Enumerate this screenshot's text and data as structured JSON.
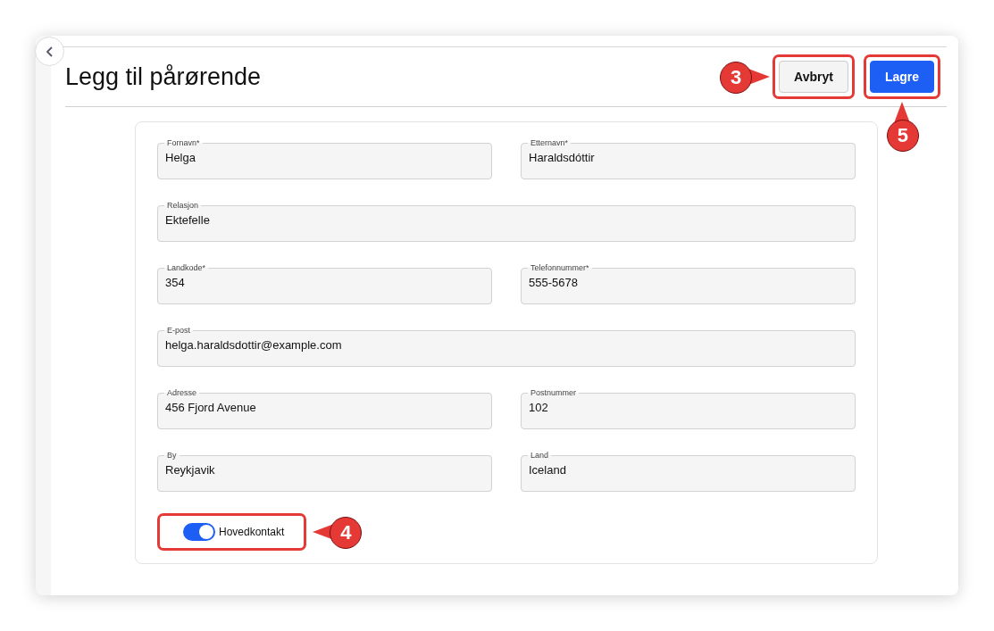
{
  "title": "Legg til pårørende",
  "buttons": [
    {
      "label": "Avbryt",
      "kind": "secondary",
      "callout": "3"
    },
    {
      "label": "Lagre",
      "kind": "primary",
      "callout": "5"
    }
  ],
  "form": {
    "rows": [
      [
        {
          "label": "Fornavn*",
          "value": "Helga"
        },
        {
          "label": "Etternavn*",
          "value": "Haraldsdóttir"
        }
      ],
      [
        {
          "label": "Relasjon",
          "value": "Ektefelle"
        }
      ],
      [
        {
          "label": "Landkode*",
          "value": "354"
        },
        {
          "label": "Telefonnummer*",
          "value": "555-5678"
        }
      ],
      [
        {
          "label": "E-post",
          "value": "helga.haraldsdottir@example.com"
        }
      ],
      [
        {
          "label": "Adresse",
          "value": "456 Fjord Avenue"
        },
        {
          "label": "Postnummer",
          "value": "102"
        }
      ],
      [
        {
          "label": "By",
          "value": "Reykjavik"
        },
        {
          "label": "Land",
          "value": "Iceland"
        }
      ]
    ],
    "main_contact": {
      "label": "Hovedkontakt",
      "on": true,
      "callout": "4"
    }
  }
}
